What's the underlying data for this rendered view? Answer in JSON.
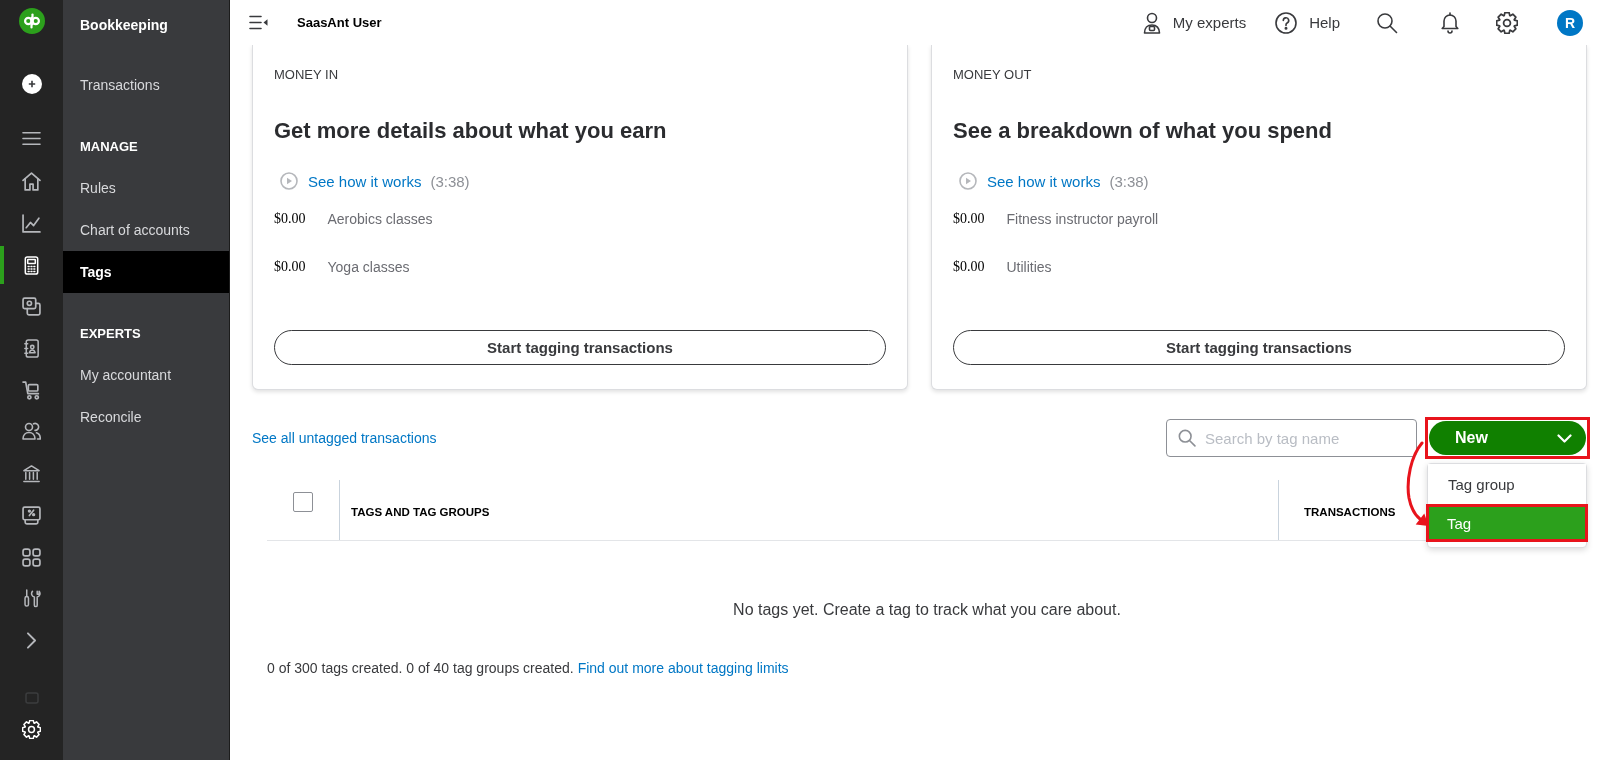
{
  "rail": {
    "nav": [
      {
        "selected": false
      },
      {
        "selected": false
      },
      {
        "selected": true
      },
      {
        "selected": false
      },
      {
        "selected": false
      },
      {
        "selected": false
      },
      {
        "selected": false
      },
      {
        "selected": false
      },
      {
        "selected": false
      },
      {
        "selected": false
      },
      {
        "selected": false
      }
    ]
  },
  "sidebar": {
    "title": "Bookkeeping",
    "sections": [
      {
        "items": [
          {
            "label": "Transactions",
            "selected": false
          }
        ]
      },
      {
        "heading": "MANAGE",
        "items": [
          {
            "label": "Rules",
            "selected": false
          },
          {
            "label": "Chart of accounts",
            "selected": false
          },
          {
            "label": "Tags",
            "selected": true
          }
        ]
      },
      {
        "heading": "EXPERTS",
        "items": [
          {
            "label": "My accountant",
            "selected": false
          },
          {
            "label": "Reconcile",
            "selected": false
          }
        ]
      }
    ]
  },
  "topbar": {
    "company": "SaasAnt User",
    "actions": [
      {
        "kind": "experts",
        "label": "My experts"
      },
      {
        "kind": "help",
        "label": "Help"
      },
      {
        "kind": "search"
      },
      {
        "kind": "notifications"
      },
      {
        "kind": "settings"
      }
    ],
    "avatar": "R"
  },
  "cards": [
    {
      "label": "MONEY IN",
      "heading": "Get more details about what you earn",
      "video_link": "See how it works",
      "video_length": "(3:38)",
      "rows": [
        {
          "amount": "$0.00",
          "category": "Aerobics classes"
        },
        {
          "amount": "$0.00",
          "category": "Yoga classes"
        }
      ],
      "button": "Start tagging transactions"
    },
    {
      "label": "MONEY OUT",
      "heading": "See a breakdown of what you spend",
      "video_link": "See how it works",
      "video_length": "(3:38)",
      "rows": [
        {
          "amount": "$0.00",
          "category": "Fitness instructor payroll"
        },
        {
          "amount": "$0.00",
          "category": "Utilities"
        }
      ],
      "button": "Start tagging transactions"
    }
  ],
  "toolbar": {
    "link": "See all untagged transactions",
    "search": {
      "placeholder": "Search by tag name"
    },
    "new_button": {
      "label": "New",
      "expanded": true,
      "highlighted": true
    },
    "menu": [
      {
        "label": "Tag group",
        "selected": false,
        "highlighted": false
      },
      {
        "label": "Tag",
        "selected": true,
        "highlighted": true
      }
    ],
    "annotation_arrow": true
  },
  "table": {
    "select_all": {
      "checked": false
    },
    "columns": [
      "TAGS AND TAG GROUPS",
      "TRANSACTIONS"
    ],
    "empty_message": "No tags yet. Create a tag to track what you care about."
  },
  "footer": {
    "text": "0 of 300 tags created. 0 of 40 tag groups created.",
    "link": "Find out more about tagging limits"
  }
}
